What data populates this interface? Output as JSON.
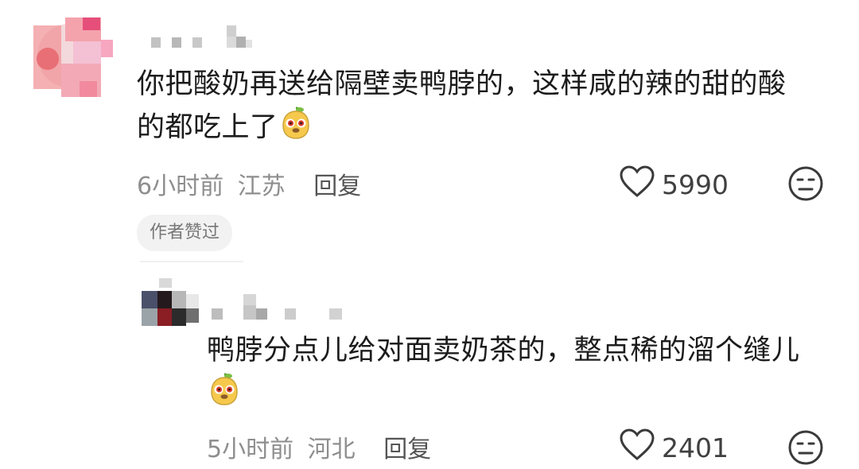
{
  "comments": [
    {
      "text": "你把酸奶再送给隔壁卖鸭脖的，这样咸的辣的甜的酸的都吃上了",
      "time": "6小时前",
      "location": "江苏",
      "reply_label": "回复",
      "like_count": "5990",
      "badge": "作者赞过",
      "reply": {
        "text": "鸭脖分点儿给对面卖奶茶的，整点稀的溜个缝儿",
        "time": "5小时前",
        "location": "河北",
        "reply_label": "回复",
        "like_count": "2401"
      }
    }
  ],
  "icons": {
    "emoji": "duck-face-emoji",
    "like": "heart-outline-icon",
    "dislike": "neutral-face-icon"
  }
}
